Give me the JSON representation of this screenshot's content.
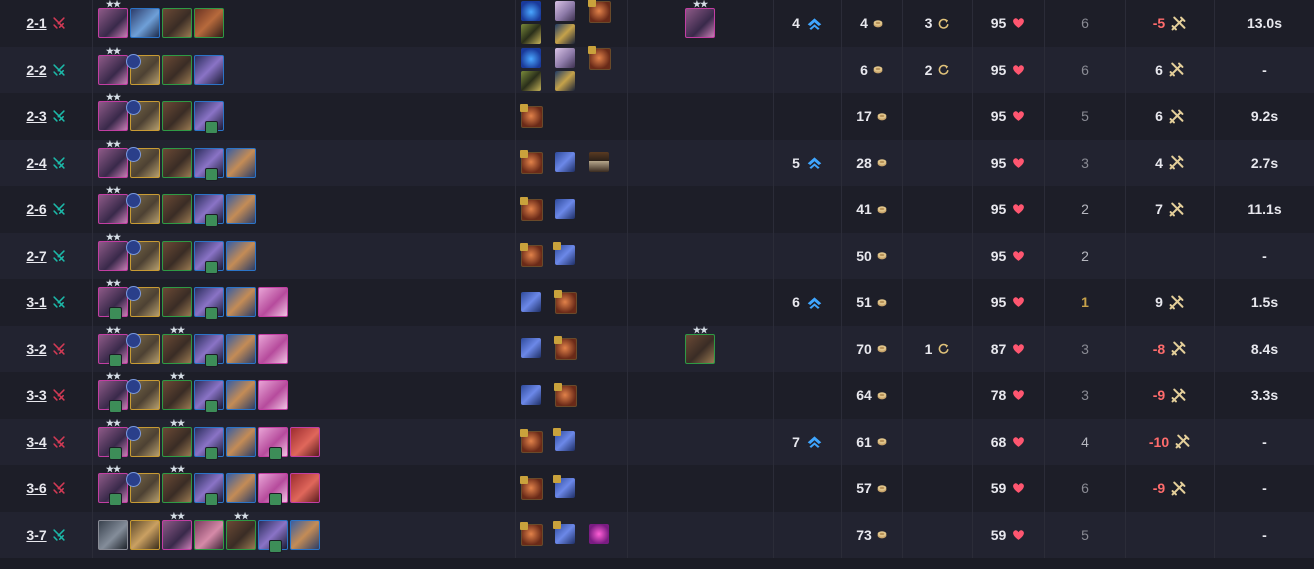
{
  "colors": {
    "win": "#1cb8a8",
    "loss": "#d23a55",
    "neg_damage": "#ff6c6c",
    "heart": "#ff5670",
    "level_up": "#3fa6ff"
  },
  "icons": {
    "win": "swords-win-icon",
    "loss": "swords-loss-icon",
    "level": "level-up-icon",
    "gold": "gold-coin-icon",
    "reroll": "reroll-icon",
    "hp": "heart-icon",
    "damage": "damage-swords-icon"
  },
  "rows": [
    {
      "stage": "2-1",
      "result": "loss",
      "units": [
        {
          "s": "veil",
          "b": "pink",
          "stars": 2
        },
        {
          "s": "blue",
          "b": "blue"
        },
        {
          "s": "brown",
          "b": "green"
        },
        {
          "s": "red",
          "b": "green"
        }
      ],
      "items": [
        [
          "tear",
          0
        ],
        [
          "stat",
          0
        ],
        [
          "spat",
          1
        ],
        [
          "bow",
          0
        ],
        [
          "sword",
          0
        ]
      ],
      "bench": [
        {
          "s": "veil",
          "b": "pink",
          "stars": 2
        }
      ],
      "level": "4",
      "gold": "4",
      "rerolls": "3",
      "hp": "95",
      "rank": "6",
      "rank_style": "normal",
      "damage": "-5",
      "damage_neg": true,
      "time": "13.0s"
    },
    {
      "stage": "2-2",
      "result": "win",
      "units": [
        {
          "s": "veil",
          "b": "pink",
          "stars": 2
        },
        {
          "s": "armor",
          "b": "gold",
          "emb": "shield"
        },
        {
          "s": "brown",
          "b": "green"
        },
        {
          "s": "dark",
          "b": "blue"
        }
      ],
      "items": [
        [
          "tear",
          0
        ],
        [
          "stat",
          0
        ],
        [
          "spat",
          1
        ],
        [
          "bow",
          0
        ],
        [
          "sword",
          0
        ]
      ],
      "bench": [],
      "level": "",
      "gold": "6",
      "rerolls": "2",
      "hp": "95",
      "rank": "6",
      "rank_style": "normal",
      "damage": "6",
      "damage_neg": false,
      "time": "-"
    },
    {
      "stage": "2-3",
      "result": "win",
      "units": [
        {
          "s": "veil",
          "b": "pink",
          "stars": 2
        },
        {
          "s": "armor",
          "b": "gold",
          "emb": "shield"
        },
        {
          "s": "brown",
          "b": "green"
        },
        {
          "s": "dark",
          "b": "blue",
          "badge": true
        }
      ],
      "items": [
        [
          "spat",
          1
        ]
      ],
      "bench": [],
      "level": "",
      "gold": "17",
      "rerolls": "",
      "hp": "95",
      "rank": "5",
      "rank_style": "normal",
      "damage": "6",
      "damage_neg": false,
      "time": "9.2s"
    },
    {
      "stage": "2-4",
      "result": "win",
      "units": [
        {
          "s": "veil",
          "b": "pink",
          "stars": 2
        },
        {
          "s": "armor",
          "b": "gold",
          "emb": "shield"
        },
        {
          "s": "brown",
          "b": "green"
        },
        {
          "s": "dark",
          "b": "blue",
          "badge": true
        },
        {
          "s": "beard",
          "b": "blue"
        }
      ],
      "items": [
        [
          "spat",
          1
        ],
        [
          "glove",
          0
        ],
        [
          "chest",
          0
        ]
      ],
      "bench": [],
      "level": "5",
      "gold": "28",
      "rerolls": "",
      "hp": "95",
      "rank": "3",
      "rank_style": "normal",
      "damage": "4",
      "damage_neg": false,
      "time": "2.7s"
    },
    {
      "stage": "2-6",
      "result": "win",
      "units": [
        {
          "s": "veil",
          "b": "pink",
          "stars": 2
        },
        {
          "s": "armor",
          "b": "gold",
          "emb": "shield"
        },
        {
          "s": "brown",
          "b": "green"
        },
        {
          "s": "dark",
          "b": "blue",
          "badge": true
        },
        {
          "s": "beard",
          "b": "blue"
        }
      ],
      "items": [
        [
          "spat",
          1
        ],
        [
          "glove",
          0
        ]
      ],
      "bench": [],
      "level": "",
      "gold": "41",
      "rerolls": "",
      "hp": "95",
      "rank": "2",
      "rank_style": "bright",
      "damage": "7",
      "damage_neg": false,
      "time": "11.1s"
    },
    {
      "stage": "2-7",
      "result": "win",
      "units": [
        {
          "s": "veil",
          "b": "pink",
          "stars": 2
        },
        {
          "s": "armor",
          "b": "gold",
          "emb": "shield"
        },
        {
          "s": "brown",
          "b": "green"
        },
        {
          "s": "dark",
          "b": "blue",
          "badge": true
        },
        {
          "s": "beard",
          "b": "blue"
        }
      ],
      "items": [
        [
          "spat",
          1
        ],
        [
          "glove",
          1
        ]
      ],
      "bench": [],
      "level": "",
      "gold": "50",
      "rerolls": "",
      "hp": "95",
      "rank": "2",
      "rank_style": "bright",
      "damage": "",
      "damage_neg": false,
      "time": "-"
    },
    {
      "stage": "3-1",
      "result": "win",
      "units": [
        {
          "s": "veil",
          "b": "pink",
          "stars": 2,
          "badge": true
        },
        {
          "s": "armor",
          "b": "gold",
          "emb": "shield"
        },
        {
          "s": "brown",
          "b": "green"
        },
        {
          "s": "dark",
          "b": "blue",
          "badge": true
        },
        {
          "s": "beard",
          "b": "blue"
        },
        {
          "s": "pinkg",
          "b": "pink"
        }
      ],
      "items": [
        [
          "glove",
          0
        ],
        [
          "spat",
          1
        ]
      ],
      "bench": [],
      "level": "6",
      "gold": "51",
      "rerolls": "",
      "hp": "95",
      "rank": "1",
      "rank_style": "gold",
      "damage": "9",
      "damage_neg": false,
      "time": "1.5s"
    },
    {
      "stage": "3-2",
      "result": "loss",
      "units": [
        {
          "s": "veil",
          "b": "pink",
          "stars": 2,
          "badge": true
        },
        {
          "s": "armor",
          "b": "gold",
          "emb": "shield"
        },
        {
          "s": "brown",
          "b": "green",
          "stars": 2
        },
        {
          "s": "dark",
          "b": "blue",
          "badge": true
        },
        {
          "s": "beard",
          "b": "blue"
        },
        {
          "s": "pinkg",
          "b": "pink"
        }
      ],
      "items": [
        [
          "glove",
          0
        ],
        [
          "spat",
          1
        ]
      ],
      "bench": [
        {
          "s": "brown",
          "b": "green",
          "stars": 2
        }
      ],
      "level": "",
      "gold": "70",
      "rerolls": "1",
      "hp": "87",
      "rank": "3",
      "rank_style": "normal",
      "damage": "-8",
      "damage_neg": true,
      "time": "8.4s"
    },
    {
      "stage": "3-3",
      "result": "loss",
      "units": [
        {
          "s": "veil",
          "b": "pink",
          "stars": 2,
          "badge": true
        },
        {
          "s": "armor",
          "b": "gold",
          "emb": "shield"
        },
        {
          "s": "brown",
          "b": "green",
          "stars": 2
        },
        {
          "s": "dark",
          "b": "blue",
          "badge": true
        },
        {
          "s": "beard",
          "b": "blue"
        },
        {
          "s": "pinkg",
          "b": "pink"
        }
      ],
      "items": [
        [
          "glove",
          0
        ],
        [
          "spat",
          1
        ]
      ],
      "bench": [],
      "level": "",
      "gold": "64",
      "rerolls": "",
      "hp": "78",
      "rank": "3",
      "rank_style": "normal",
      "damage": "-9",
      "damage_neg": true,
      "time": "3.3s"
    },
    {
      "stage": "3-4",
      "result": "loss",
      "units": [
        {
          "s": "veil",
          "b": "pink",
          "stars": 2,
          "badge": true
        },
        {
          "s": "armor",
          "b": "gold",
          "emb": "shield"
        },
        {
          "s": "brown",
          "b": "green",
          "stars": 2
        },
        {
          "s": "dark",
          "b": "blue",
          "badge": true
        },
        {
          "s": "beard",
          "b": "blue"
        },
        {
          "s": "pinkg",
          "b": "pink",
          "badge": true
        },
        {
          "s": "brute",
          "b": "pink"
        }
      ],
      "items": [
        [
          "spat",
          1
        ],
        [
          "glove",
          1
        ]
      ],
      "bench": [],
      "level": "7",
      "gold": "61",
      "rerolls": "",
      "hp": "68",
      "rank": "4",
      "rank_style": "bright",
      "damage": "-10",
      "damage_neg": true,
      "time": "-"
    },
    {
      "stage": "3-6",
      "result": "loss",
      "units": [
        {
          "s": "veil",
          "b": "pink",
          "stars": 2,
          "badge": true
        },
        {
          "s": "armor",
          "b": "gold",
          "emb": "shield"
        },
        {
          "s": "brown",
          "b": "green",
          "stars": 2
        },
        {
          "s": "dark",
          "b": "blue",
          "badge": true
        },
        {
          "s": "beard",
          "b": "blue"
        },
        {
          "s": "pinkg",
          "b": "pink",
          "badge": true
        },
        {
          "s": "brute",
          "b": "pink"
        }
      ],
      "items": [
        [
          "spat",
          1
        ],
        [
          "glove",
          1
        ]
      ],
      "bench": [],
      "level": "",
      "gold": "57",
      "rerolls": "",
      "hp": "59",
      "rank": "6",
      "rank_style": "normal",
      "damage": "-9",
      "damage_neg": true,
      "time": "-"
    },
    {
      "stage": "3-7",
      "result": "win",
      "units": [
        {
          "s": "armgr",
          "b": "gray"
        },
        {
          "s": "gold",
          "b": "gold"
        },
        {
          "s": "veil",
          "b": "pink",
          "stars": 2
        },
        {
          "s": "pinkl",
          "b": "green"
        },
        {
          "s": "brown",
          "b": "green",
          "stars": 2
        },
        {
          "s": "dark",
          "b": "blue",
          "badge": true
        },
        {
          "s": "beard",
          "b": "blue"
        }
      ],
      "items": [
        [
          "spat",
          1
        ],
        [
          "glove",
          1
        ],
        [
          "pinkd",
          0
        ]
      ],
      "bench": [],
      "level": "",
      "gold": "73",
      "rerolls": "",
      "hp": "59",
      "rank": "5",
      "rank_style": "normal",
      "damage": "",
      "damage_neg": false,
      "time": "-"
    }
  ]
}
